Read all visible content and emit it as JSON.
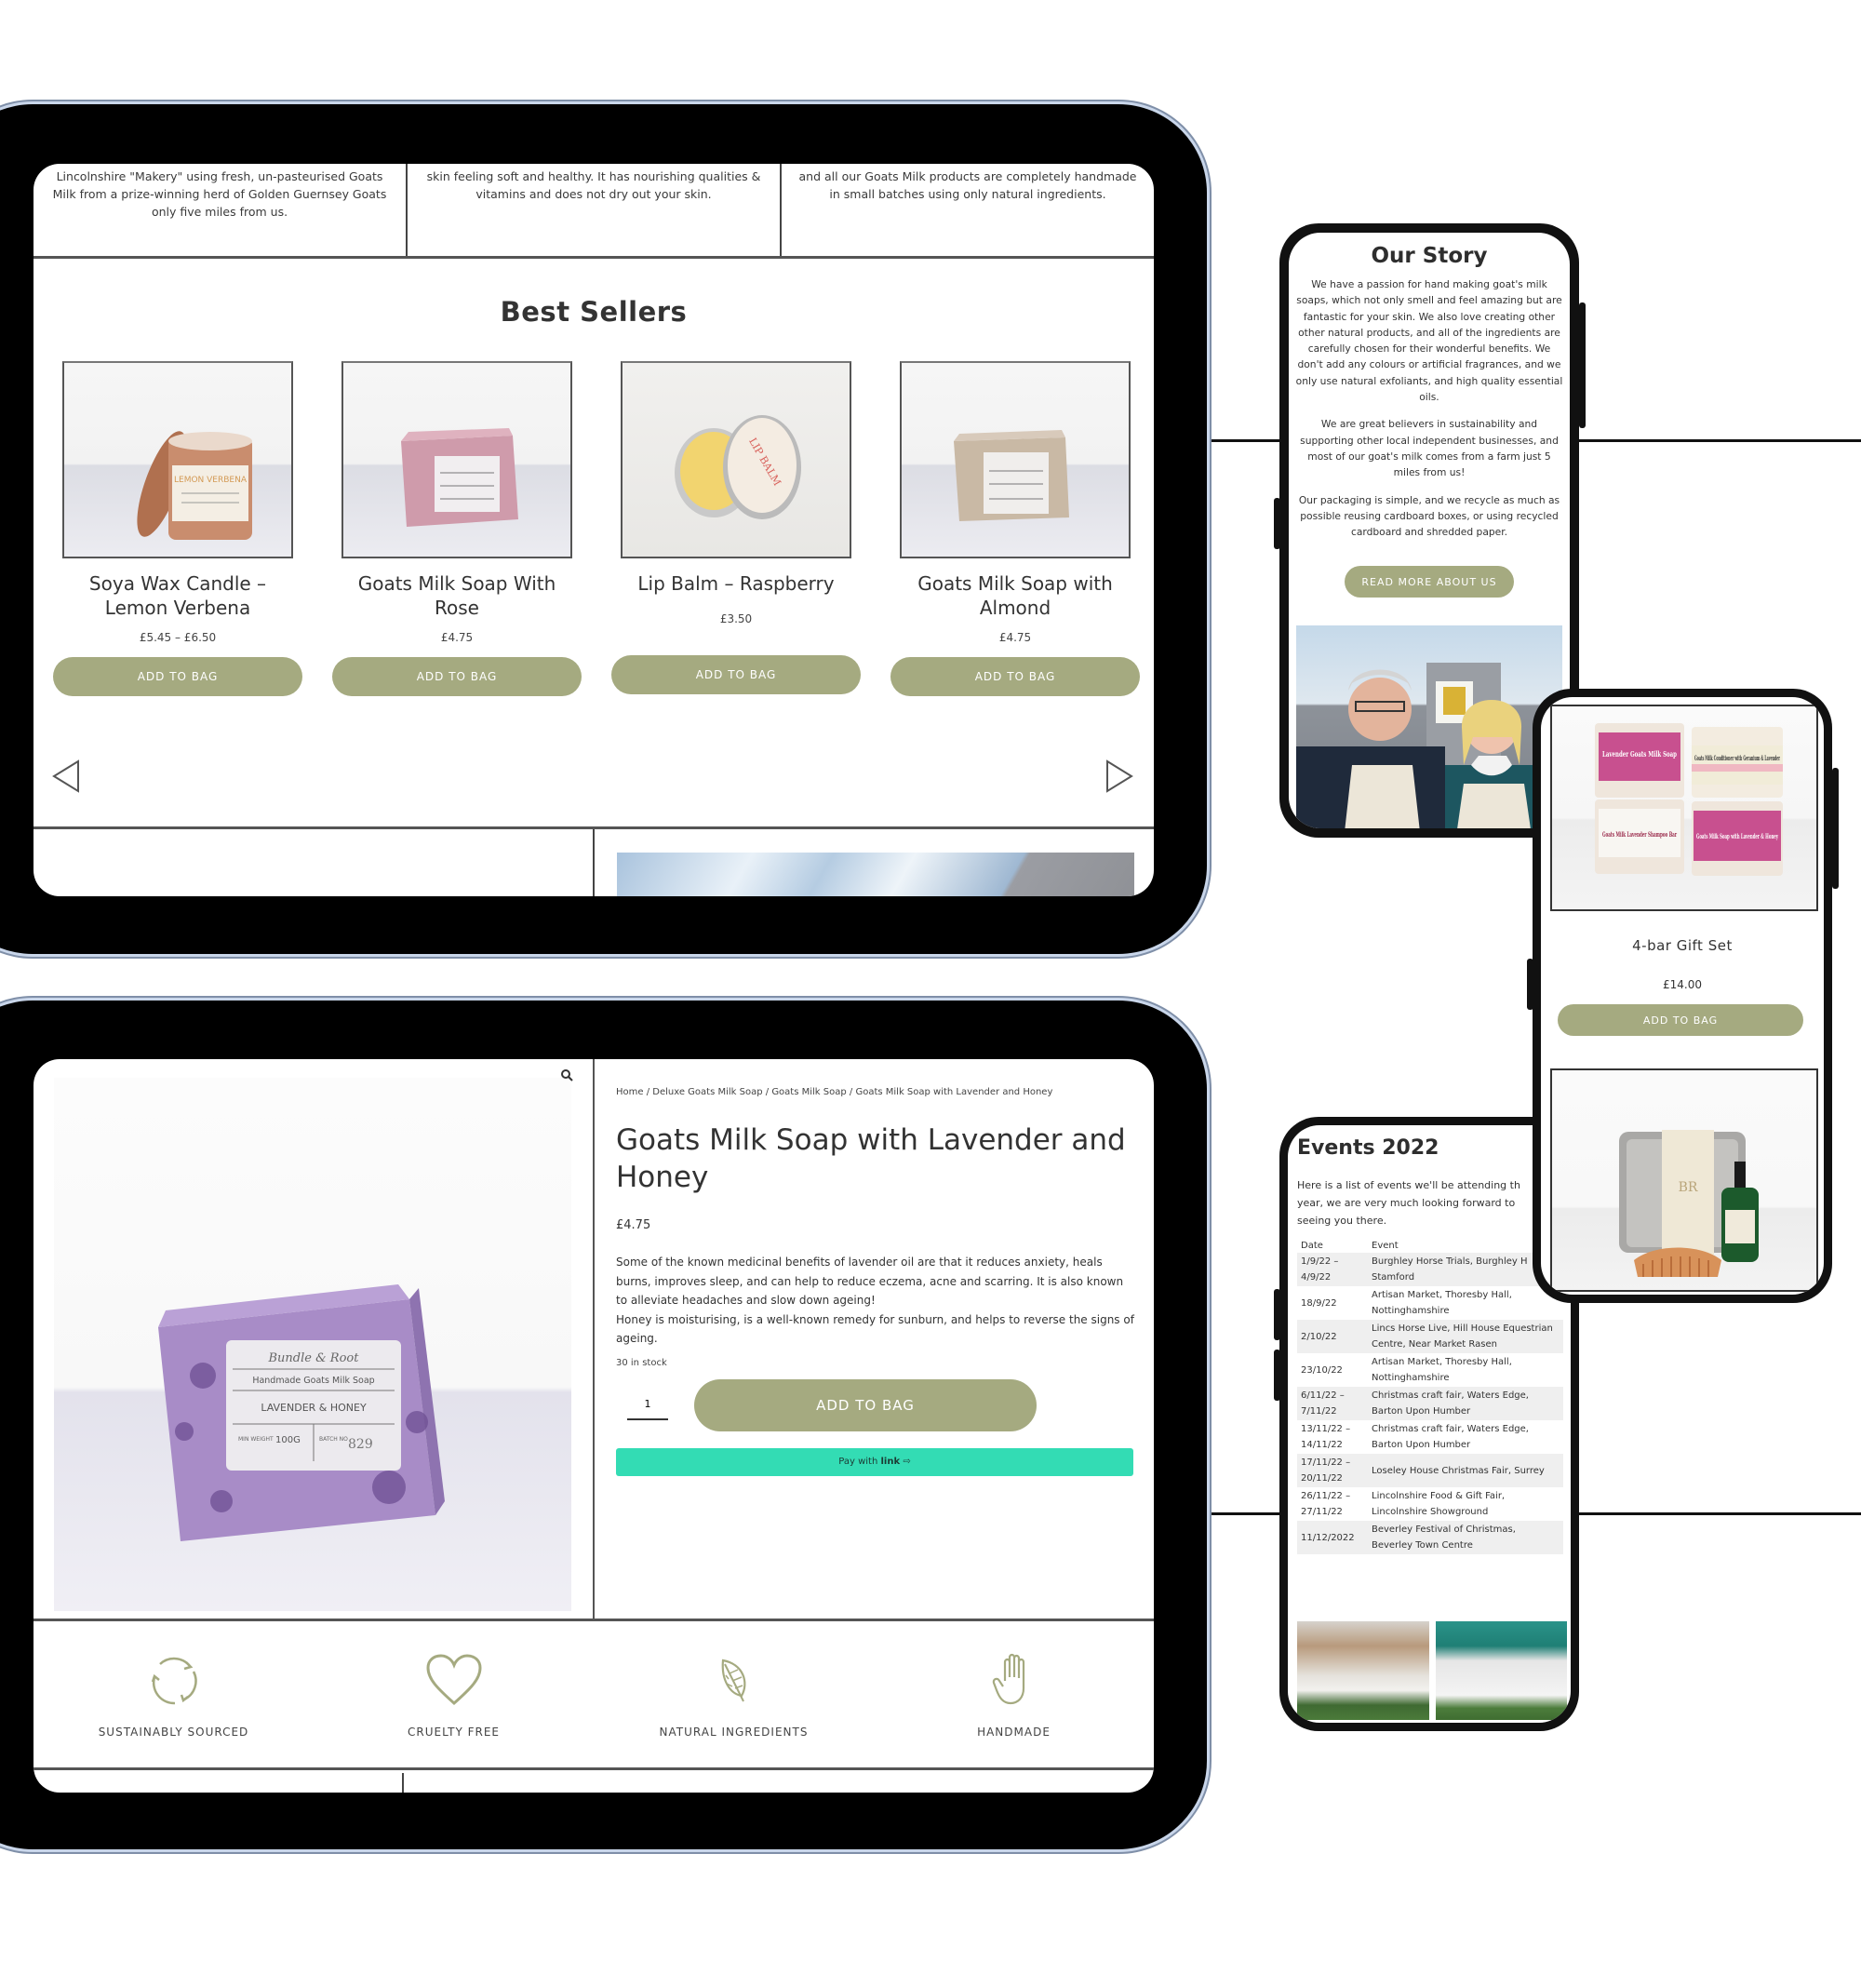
{
  "brand_colors": {
    "sage": "#a5aa80",
    "link_green": "#33dcb4",
    "text": "#333333"
  },
  "tablet_home": {
    "intro_columns": [
      "Lincolnshire \"Makery\" using fresh, un-pasteurised Goats Milk from a prize-winning herd of Golden Guernsey Goats only five miles from us.",
      "skin feeling soft and healthy. It has nourishing qualities & vitamins and does not dry out your skin.",
      "and all our Goats Milk products are completely handmade in small batches using only natural ingredients."
    ],
    "best_sellers_title": "Best Sellers",
    "products": [
      {
        "name": "Soya Wax Candle – Lemon Verbena",
        "price": "£5.45 – £6.50",
        "button": "ADD TO BAG",
        "image": "candle-tin"
      },
      {
        "name": "Goats Milk Soap With Rose",
        "price": "£4.75",
        "button": "ADD TO BAG",
        "image": "pink-soap"
      },
      {
        "name": "Lip Balm – Raspberry",
        "price": "£3.50",
        "button": "ADD TO BAG",
        "image": "lip-balm-tin"
      },
      {
        "name": "Goats Milk Soap with Almond",
        "price": "£4.75",
        "button": "ADD TO BAG",
        "image": "beige-soap"
      }
    ],
    "carousel": {
      "prev_icon": "triangle-left-icon",
      "next_icon": "triangle-right-icon"
    }
  },
  "tablet_product": {
    "breadcrumb": [
      "Home",
      "Deluxe Goats Milk Soap",
      "Goats Milk Soap",
      "Goats Milk Soap with Lavender and Honey"
    ],
    "breadcrumb_separator": " / ",
    "title": "Goats Milk Soap with Lavender and Honey",
    "price": "£4.75",
    "description": [
      "Some of the known medicinal benefits of lavender oil are that it reduces anxiety, heals burns, improves sleep, and can help to reduce eczema, acne and scarring. It is also known to alleviate headaches and slow down ageing!",
      "Honey is moisturising, is a well-known remedy for sunburn, and helps to reverse the signs of ageing."
    ],
    "stock": "30 in stock",
    "quantity": "1",
    "add_button": "ADD TO BAG",
    "pay_link": {
      "prefix": "Pay with ",
      "brand": "link",
      "arrow": "⇨"
    },
    "zoom_icon": "magnifier-icon",
    "soap_label": {
      "brand": "Bundle & Root",
      "line1": "Handmade Goats Milk Soap",
      "line2": "LAVENDER & HONEY",
      "weight_label": "MIN WEIGHT",
      "weight": "100G",
      "batch_label": "BATCH NO",
      "batch": "829"
    },
    "features": [
      {
        "label": "SUSTAINABLY SOURCED",
        "icon": "recycle-icon"
      },
      {
        "label": "CRUELTY FREE",
        "icon": "heart-icon"
      },
      {
        "label": "NATURAL INGREDIENTS",
        "icon": "leaf-icon"
      },
      {
        "label": "HANDMADE",
        "icon": "hand-icon"
      }
    ]
  },
  "phone_story": {
    "title": "Our Story",
    "paragraphs": [
      "We have a passion for hand making goat's milk soaps, which not only smell and feel amazing but are fantastic for your skin. We also love creating other other natural products, and all of the ingredients are carefully chosen for their wonderful benefits. We don't add any colours or artificial fragrances, and we only use natural exfoliants, and high quality essential oils.",
      "We are great believers in sustainability and supporting other local independent businesses, and most of our goat's milk comes from a farm just 5 miles from us!",
      "Our packaging is simple, and we recycle as much as possible reusing cardboard boxes, or using recycled cardboard and shredded paper."
    ],
    "button": "READ MORE ABOUT US",
    "photo": "owners-photo"
  },
  "phone_gift": {
    "product_name": "4-bar Gift Set",
    "price": "£14.00",
    "button": "ADD TO BAG",
    "bar_labels": [
      "Lavender Goats Milk Soap",
      "Goats Milk Conditioner with Geranium & Lavender",
      "Goats Milk Lavender Shampoo Bar",
      "Goats Milk Soap with Lavender & Honey"
    ],
    "second_image": "beard-gift-set"
  },
  "phone_events": {
    "title": "Events 2022",
    "intro_lines": [
      "Here is a list of events we'll be attending th",
      "year, we are very much looking forward to",
      "seeing you there."
    ],
    "columns": [
      "Date",
      "Event"
    ],
    "rows": [
      {
        "date": [
          "1/9/22 –",
          "4/9/22"
        ],
        "event": [
          "Burghley Horse Trials, Burghley H",
          "Stamford"
        ]
      },
      {
        "date": [
          "18/9/22"
        ],
        "event": [
          "Artisan Market, Thoresby Hall,",
          "Nottinghamshire"
        ]
      },
      {
        "date": [
          "2/10/22"
        ],
        "event": [
          "Lincs Horse Live, Hill House Equestrian",
          "Centre, Near Market Rasen"
        ]
      },
      {
        "date": [
          "23/10/22"
        ],
        "event": [
          "Artisan Market, Thoresby Hall,",
          "Nottinghamshire"
        ]
      },
      {
        "date": [
          "6/11/22 –",
          "7/11/22"
        ],
        "event": [
          "Christmas craft fair, Waters Edge,",
          "Barton Upon Humber"
        ]
      },
      {
        "date": [
          "13/11/22 –",
          "14/11/22"
        ],
        "event": [
          "Christmas craft fair, Waters Edge,",
          "Barton Upon Humber"
        ]
      },
      {
        "date": [
          "17/11/22 –",
          "20/11/22"
        ],
        "event": [
          "Loseley House Christmas Fair, Surrey"
        ]
      },
      {
        "date": [
          "26/11/22 –",
          "27/11/22"
        ],
        "event": [
          "Lincolnshire Food & Gift Fair,",
          "Lincolnshire Showground"
        ]
      },
      {
        "date": [
          "11/12/2022"
        ],
        "event": [
          "Beverley Festival of Christmas,",
          "Beverley Town Centre"
        ]
      }
    ],
    "photos": [
      "indoor-stall-photo",
      "outdoor-gazebo-stall-photo"
    ]
  }
}
